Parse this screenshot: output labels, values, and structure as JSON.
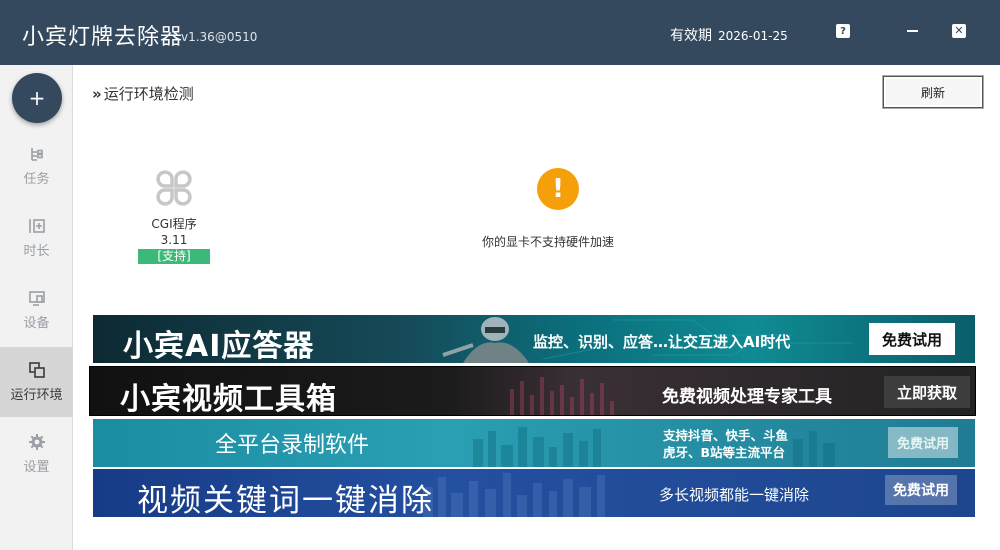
{
  "app": {
    "title": "小宾灯牌去除器",
    "version": "v1.36@0510",
    "expiry_label": "有效期",
    "expiry_date": "2026-01-25"
  },
  "window_controls": {
    "help": "?",
    "close": "✕"
  },
  "sidebar": {
    "add_label": "+",
    "items": [
      {
        "label": "任务",
        "icon": "task-tree-icon"
      },
      {
        "label": "时长",
        "icon": "duration-icon"
      },
      {
        "label": "设备",
        "icon": "device-icon"
      },
      {
        "label": "运行环境",
        "icon": "environment-icon",
        "active": true
      },
      {
        "label": "设置",
        "icon": "gear-icon"
      }
    ]
  },
  "main": {
    "section_title": "运行环境检测",
    "section_prefix": "»",
    "refresh_label": "刷新",
    "cgi": {
      "name": "CGI程序",
      "version": "3.11",
      "status": "[支持]"
    },
    "warning": {
      "icon": "!",
      "text": "你的显卡不支持硬件加速"
    }
  },
  "banners": [
    {
      "title": "小宾AI应答器",
      "desc": "监控、识别、应答…让交互进入AI时代",
      "button": "免费试用"
    },
    {
      "title": "小宾视频工具箱",
      "desc": "免费视频处理专家工具",
      "button": "立即获取"
    },
    {
      "title": "全平台录制软件",
      "desc_line1": "支持抖音、快手、斗鱼",
      "desc_line2": "虎牙、B站等主流平台",
      "button": "免费试用"
    },
    {
      "title": "视频关键词一键消除",
      "desc": "多长视频都能一键消除",
      "button": "免费试用"
    }
  ],
  "colors": {
    "titlebar": "#34495e",
    "sidebar_bg": "#f2f2f2",
    "active_nav": "#d6d6d6",
    "support_badge": "#3cb878",
    "warning": "#f5a00a"
  }
}
